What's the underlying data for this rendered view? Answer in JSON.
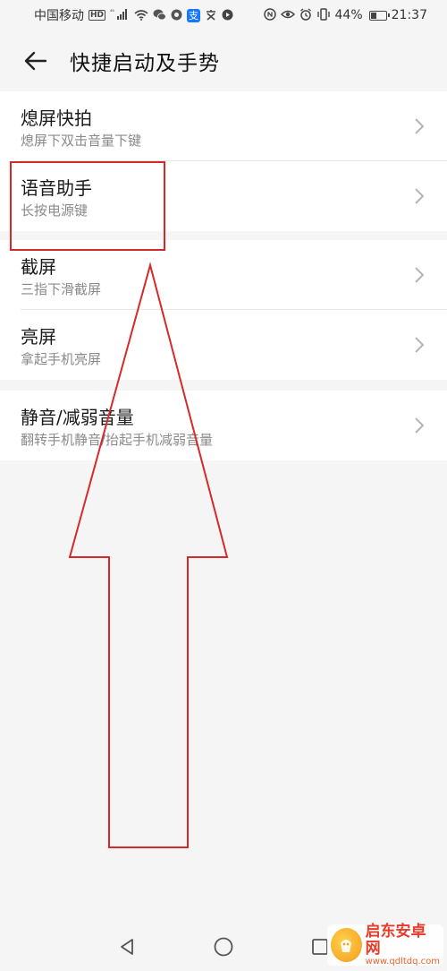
{
  "status_bar": {
    "carrier": "中国移动",
    "hd_badge": "HD",
    "signal_badge": "⁴⁶",
    "alipay_char": "支",
    "battery": "44%",
    "battery_level": 0.44,
    "time": "21:37"
  },
  "header": {
    "title": "快捷启动及手势"
  },
  "groups": [
    {
      "items": [
        {
          "title": "熄屏快拍",
          "subtitle": "熄屏下双击音量下键"
        },
        {
          "title": "语音助手",
          "subtitle": "长按电源键"
        }
      ]
    },
    {
      "items": [
        {
          "title": "截屏",
          "subtitle": "三指下滑截屏"
        },
        {
          "title": "亮屏",
          "subtitle": "拿起手机亮屏"
        }
      ]
    },
    {
      "items": [
        {
          "title": "静音/减弱音量",
          "subtitle": "翻转手机静音/抬起手机减弱音量"
        }
      ]
    }
  ],
  "watermark": {
    "name": "启东安卓网",
    "url": "www.qdltdq.com"
  },
  "colors": {
    "annotation_red": "#d42a2a",
    "background": "#f5f5f5",
    "subtitle_gray": "#8a8a8a"
  }
}
